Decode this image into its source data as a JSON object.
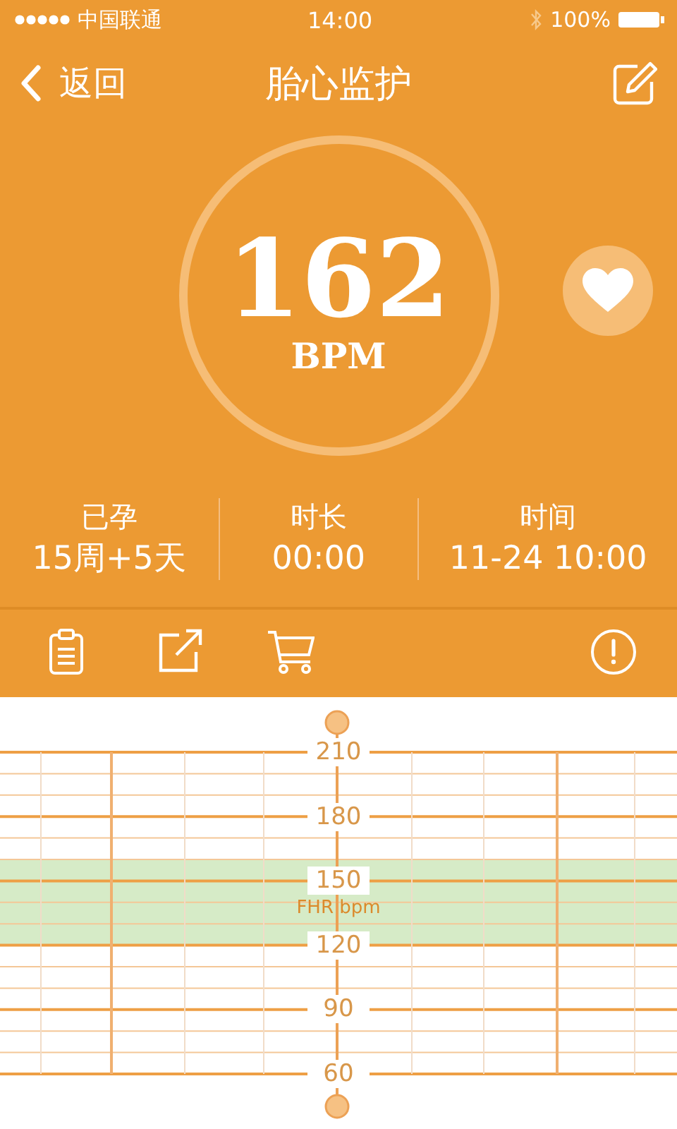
{
  "status_bar": {
    "carrier": "中国联通",
    "time": "14:00",
    "battery": "100%"
  },
  "nav": {
    "back": "返回",
    "title": "胎心监护"
  },
  "heart_rate": {
    "value": "162",
    "unit": "BPM"
  },
  "stats": [
    {
      "label": "已孕",
      "value": "15周+5天"
    },
    {
      "label": "时长",
      "value": "00:00"
    },
    {
      "label": "时间",
      "value": "11-24 10:00"
    }
  ],
  "toolbar": [
    {
      "kind": "clipboard"
    },
    {
      "kind": "share"
    },
    {
      "kind": "cart"
    },
    {
      "kind": "info"
    }
  ],
  "chart": {
    "axis_label": "FHR bpm",
    "ticks": [
      "210",
      "180",
      "150",
      "120",
      "90",
      "60"
    ]
  }
}
